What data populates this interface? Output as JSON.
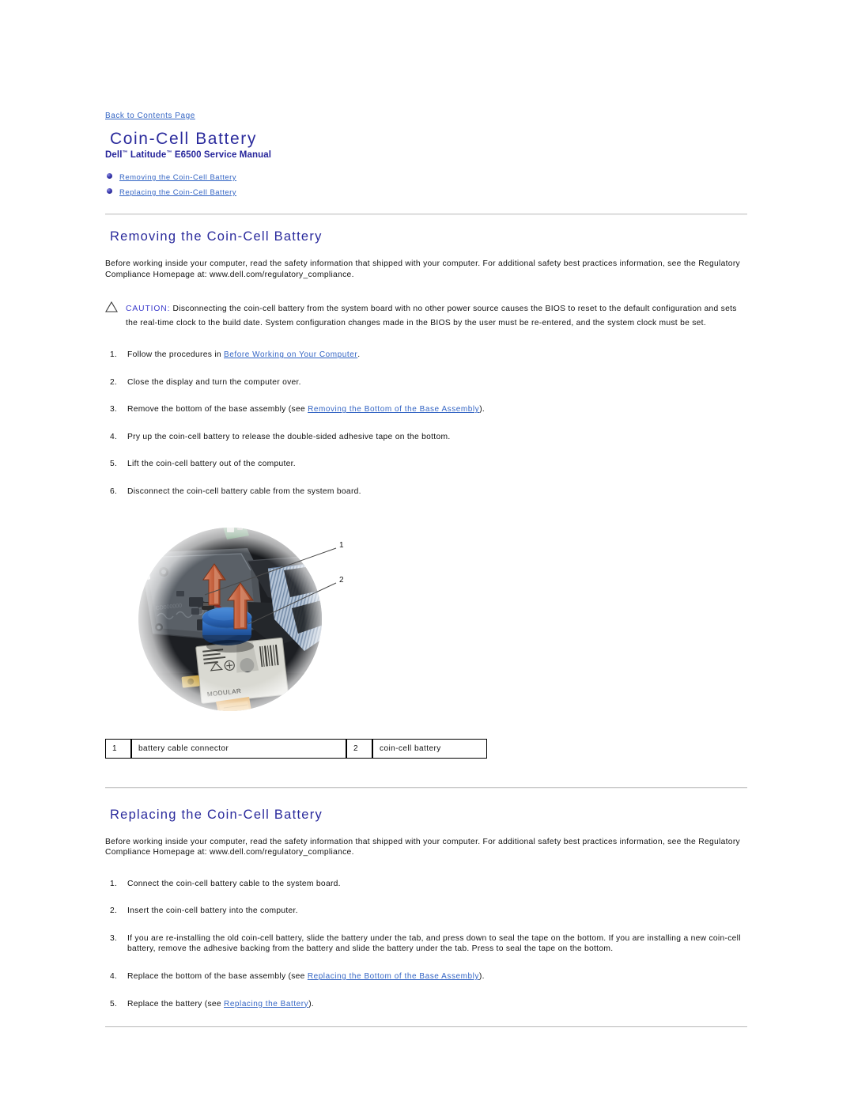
{
  "header": {
    "back_link": "Back to Contents Page",
    "title": "Coin-Cell Battery",
    "subtitle_prefix": "Dell",
    "subtitle_tm1": "™",
    "subtitle_mid": " Latitude",
    "subtitle_tm2": "™",
    "subtitle_suffix": " E6500 Service Manual",
    "toc": [
      "Removing the Coin-Cell Battery",
      "Replacing the Coin-Cell Battery"
    ]
  },
  "removing": {
    "heading": "Removing the Coin-Cell Battery",
    "intro": "Before working inside your computer, read the safety information that shipped with your computer. For additional safety best practices information, see the Regulatory Compliance Homepage at: www.dell.com/regulatory_compliance.",
    "caution_label": "CAUTION:",
    "caution_text": " Disconnecting the coin-cell battery from the system board with no other power source causes the BIOS to reset to the default configuration and sets the real-time clock to the build date. System configuration changes made in the BIOS by the user must be re-entered, and the system clock must be set.",
    "steps": [
      {
        "num": "1.",
        "pre": "Follow the procedures in ",
        "link": "Before Working on Your Computer",
        "post": "."
      },
      {
        "num": "2.",
        "pre": "Close the display and turn the computer over.",
        "link": "",
        "post": ""
      },
      {
        "num": "3.",
        "pre": "Remove the bottom of the base assembly (see ",
        "link": "Removing the Bottom of the Base Assembly",
        "post": ")."
      },
      {
        "num": "4.",
        "pre": "Pry up the coin-cell battery to release the double-sided adhesive tape on the bottom.",
        "link": "",
        "post": ""
      },
      {
        "num": "5.",
        "pre": "Lift the coin-cell battery out of the computer.",
        "link": "",
        "post": ""
      },
      {
        "num": "6.",
        "pre": "Disconnect the coin-cell battery cable from the system board.",
        "link": "",
        "post": ""
      }
    ],
    "figure": {
      "alt": "Photo of laptop base interior showing coin-cell battery and its cable connector",
      "callouts": [
        {
          "id": "1",
          "label": "battery cable connector"
        },
        {
          "id": "2",
          "label": "coin-cell battery"
        }
      ]
    },
    "legend": [
      {
        "key": "1",
        "value": "battery cable connector"
      },
      {
        "key": "2",
        "value": "coin-cell battery"
      }
    ]
  },
  "replacing": {
    "heading": "Replacing the Coin-Cell Battery",
    "intro": "Before working inside your computer, read the safety information that shipped with your computer. For additional safety best practices information, see the Regulatory Compliance Homepage at: www.dell.com/regulatory_compliance.",
    "steps": [
      {
        "num": "1.",
        "pre": "Connect the coin-cell battery cable to the system board.",
        "link": "",
        "post": ""
      },
      {
        "num": "2.",
        "pre": "Insert the coin-cell battery into the computer.",
        "link": "",
        "post": ""
      },
      {
        "num": "3.",
        "pre": "If you are re-installing the old coin-cell battery, slide the battery under the tab, and press down to seal the tape on the bottom. If you are installing a new coin-cell battery, remove the adhesive backing from the battery and slide the battery under the tab. Press to seal the tape on the bottom.",
        "link": "",
        "post": ""
      },
      {
        "num": "4.",
        "pre": "Replace the bottom of the base assembly (see ",
        "link": "Replacing the Bottom of the Base Assembly",
        "post": ")."
      },
      {
        "num": "5.",
        "pre": "Replace the battery (see ",
        "link": "Replacing the Battery",
        "post": ")."
      }
    ]
  },
  "colors": {
    "heading_blue": "#2A2A9C",
    "link_blue": "#3465C4",
    "caution_blue": "#3B3BCC",
    "rule_gray": "#C9C9C9",
    "battery_blue": "#2D6BC4",
    "arrow_orange": "#C96A4A"
  }
}
